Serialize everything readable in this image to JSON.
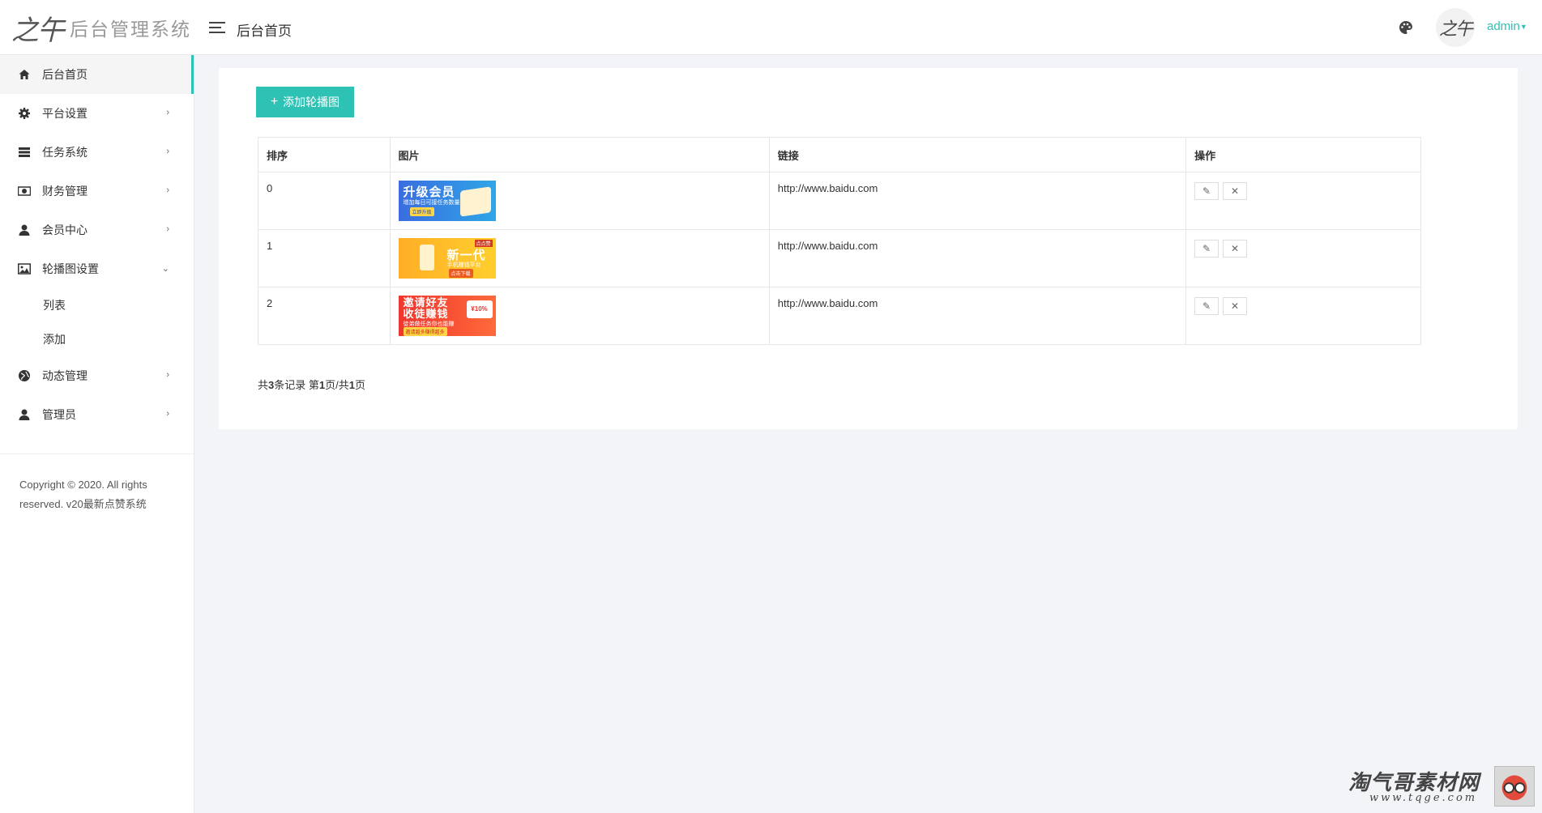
{
  "header": {
    "logo_mark": "之午",
    "logo_text": "后台管理系统",
    "page_title": "后台首页",
    "username": "admin",
    "avatar_text": "之午"
  },
  "sidebar": {
    "items": [
      {
        "label": "后台首页",
        "icon": "home-icon"
      },
      {
        "label": "平台设置",
        "icon": "gear-icon"
      },
      {
        "label": "任务系统",
        "icon": "server-icon"
      },
      {
        "label": "财务管理",
        "icon": "money-icon"
      },
      {
        "label": "会员中心",
        "icon": "user-icon"
      },
      {
        "label": "轮播图设置",
        "icon": "image-icon"
      },
      {
        "label": "动态管理",
        "icon": "globe-icon"
      },
      {
        "label": "管理员",
        "icon": "user-icon"
      }
    ],
    "sub_items": [
      "列表",
      "添加"
    ],
    "copyright": "Copyright © 2020. All rights reserved. v20最新点赞系统"
  },
  "main": {
    "add_button": "添加轮播图",
    "columns": [
      "排序",
      "图片",
      "链接",
      "操作"
    ],
    "rows": [
      {
        "order": "0",
        "link": "http://www.baidu.com",
        "banner": {
          "title": "升级会员",
          "sub": "增加每日可接任务数量",
          "tag": "立即升级"
        }
      },
      {
        "order": "1",
        "link": "http://www.baidu.com",
        "banner": {
          "title": "新一代",
          "sub": "手机赚钱平台",
          "tag": "点击下载",
          "corner": "点点赞"
        }
      },
      {
        "order": "2",
        "link": "http://www.baidu.com",
        "banner": {
          "title": "邀请好友 收徒赚钱",
          "sub": "徒弟做任务你也能赚",
          "tag": "邀请越多赚得越多",
          "badge": "¥10%"
        }
      }
    ],
    "pager": {
      "prefix": "共",
      "total": "3",
      "mid1": "条记录 第",
      "page": "1",
      "mid2": "页/共",
      "pages": "1",
      "suffix": "页"
    }
  },
  "watermark": {
    "text": "淘气哥素材网",
    "url": "www.tqge.com"
  },
  "colors": {
    "accent": "#2ec2b4",
    "background": "#f3f4f8"
  }
}
